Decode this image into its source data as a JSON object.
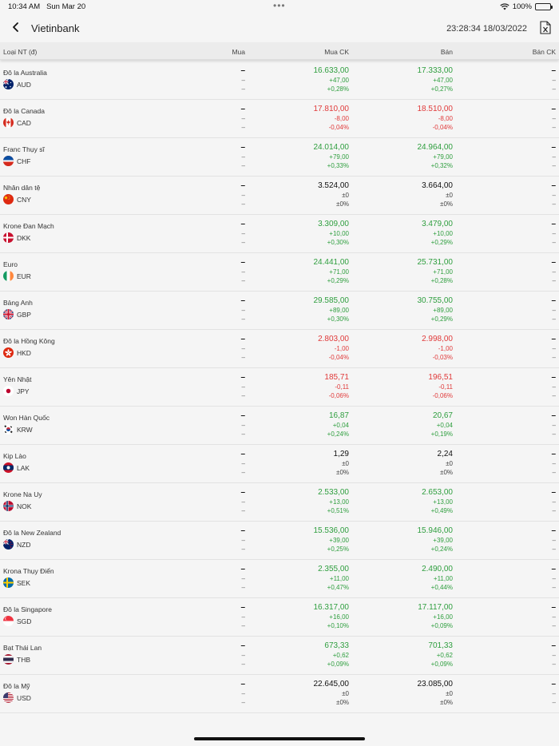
{
  "status": {
    "time": "10:34 AM",
    "date": "Sun Mar 20",
    "battery": "100%",
    "battery_level": 1.0
  },
  "nav": {
    "title": "Vietinbank",
    "timestamp": "23:28:34 18/03/2022",
    "back_icon": "chevron-left-icon",
    "export_icon": "excel-export-icon"
  },
  "header": {
    "col_currency": "Loại NT (đ)",
    "col_buy": "Mua",
    "col_buy_transfer": "Mua CK",
    "col_sell": "Bán",
    "col_sell_transfer": "Bán CK"
  },
  "empty": {
    "value": "–",
    "sub": "–"
  },
  "rows": [
    {
      "name": "Đô la Australia",
      "code": "AUD",
      "trend": "up",
      "buy_ck": {
        "value": "16.633,00",
        "change": "+47,00",
        "pct": "+0,28%"
      },
      "sell": {
        "value": "17.333,00",
        "change": "+47,00",
        "pct": "+0,27%"
      }
    },
    {
      "name": "Đô la Canada",
      "code": "CAD",
      "trend": "down",
      "buy_ck": {
        "value": "17.810,00",
        "change": "-8,00",
        "pct": "-0,04%"
      },
      "sell": {
        "value": "18.510,00",
        "change": "-8,00",
        "pct": "-0,04%"
      }
    },
    {
      "name": "Franc Thụy sĩ",
      "code": "CHF",
      "trend": "up",
      "buy_ck": {
        "value": "24.014,00",
        "change": "+79,00",
        "pct": "+0,33%"
      },
      "sell": {
        "value": "24.964,00",
        "change": "+79,00",
        "pct": "+0,32%"
      }
    },
    {
      "name": "Nhân dân tệ",
      "code": "CNY",
      "trend": "flat",
      "buy_ck": {
        "value": "3.524,00",
        "change": "±0",
        "pct": "±0%"
      },
      "sell": {
        "value": "3.664,00",
        "change": "±0",
        "pct": "±0%"
      }
    },
    {
      "name": "Krone Đan Mạch",
      "code": "DKK",
      "trend": "up",
      "buy_ck": {
        "value": "3.309,00",
        "change": "+10,00",
        "pct": "+0,30%"
      },
      "sell": {
        "value": "3.479,00",
        "change": "+10,00",
        "pct": "+0,29%"
      }
    },
    {
      "name": "Euro",
      "code": "EUR",
      "trend": "up",
      "buy_ck": {
        "value": "24.441,00",
        "change": "+71,00",
        "pct": "+0,29%"
      },
      "sell": {
        "value": "25.731,00",
        "change": "+71,00",
        "pct": "+0,28%"
      }
    },
    {
      "name": "Bảng Anh",
      "code": "GBP",
      "trend": "up",
      "buy_ck": {
        "value": "29.585,00",
        "change": "+89,00",
        "pct": "+0,30%"
      },
      "sell": {
        "value": "30.755,00",
        "change": "+89,00",
        "pct": "+0,29%"
      }
    },
    {
      "name": "Đô la Hồng Kông",
      "code": "HKD",
      "trend": "down",
      "buy_ck": {
        "value": "2.803,00",
        "change": "-1,00",
        "pct": "-0,04%"
      },
      "sell": {
        "value": "2.998,00",
        "change": "-1,00",
        "pct": "-0,03%"
      }
    },
    {
      "name": "Yên Nhật",
      "code": "JPY",
      "trend": "down",
      "buy_ck": {
        "value": "185,71",
        "change": "-0,11",
        "pct": "-0,06%"
      },
      "sell": {
        "value": "196,51",
        "change": "-0,11",
        "pct": "-0,06%"
      }
    },
    {
      "name": "Won Hàn Quốc",
      "code": "KRW",
      "trend": "up",
      "buy_ck": {
        "value": "16,87",
        "change": "+0,04",
        "pct": "+0,24%"
      },
      "sell": {
        "value": "20,67",
        "change": "+0,04",
        "pct": "+0,19%"
      }
    },
    {
      "name": "Kip Lào",
      "code": "LAK",
      "trend": "flat",
      "buy_ck": {
        "value": "1,29",
        "change": "±0",
        "pct": "±0%"
      },
      "sell": {
        "value": "2,24",
        "change": "±0",
        "pct": "±0%"
      }
    },
    {
      "name": "Krone Na Uy",
      "code": "NOK",
      "trend": "up",
      "buy_ck": {
        "value": "2.533,00",
        "change": "+13,00",
        "pct": "+0,51%"
      },
      "sell": {
        "value": "2.653,00",
        "change": "+13,00",
        "pct": "+0,49%"
      }
    },
    {
      "name": "Đô la New Zealand",
      "code": "NZD",
      "trend": "up",
      "buy_ck": {
        "value": "15.536,00",
        "change": "+39,00",
        "pct": "+0,25%"
      },
      "sell": {
        "value": "15.946,00",
        "change": "+39,00",
        "pct": "+0,24%"
      }
    },
    {
      "name": "Krona Thụy Điển",
      "code": "SEK",
      "trend": "up",
      "buy_ck": {
        "value": "2.355,00",
        "change": "+11,00",
        "pct": "+0,47%"
      },
      "sell": {
        "value": "2.490,00",
        "change": "+11,00",
        "pct": "+0,44%"
      }
    },
    {
      "name": "Đô la Singapore",
      "code": "SGD",
      "trend": "up",
      "buy_ck": {
        "value": "16.317,00",
        "change": "+16,00",
        "pct": "+0,10%"
      },
      "sell": {
        "value": "17.117,00",
        "change": "+16,00",
        "pct": "+0,09%"
      }
    },
    {
      "name": "Bạt Thái Lan",
      "code": "THB",
      "trend": "up",
      "buy_ck": {
        "value": "673,33",
        "change": "+0,62",
        "pct": "+0,09%"
      },
      "sell": {
        "value": "701,33",
        "change": "+0,62",
        "pct": "+0,09%"
      }
    },
    {
      "name": "Đô la Mỹ",
      "code": "USD",
      "trend": "flat",
      "buy_ck": {
        "value": "22.645,00",
        "change": "±0",
        "pct": "±0%"
      },
      "sell": {
        "value": "23.085,00",
        "change": "±0",
        "pct": "±0%"
      }
    }
  ],
  "colors": {
    "up": "#2e9e3e",
    "down": "#e03a3a",
    "flat": "#111111"
  }
}
